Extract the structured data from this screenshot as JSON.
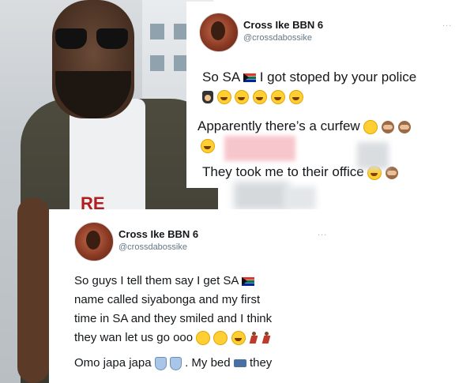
{
  "tweet1": {
    "name": "Cross Ike BBN 6",
    "handle": "@crossdabossike",
    "more": "...",
    "lines": [
      "So SA",
      "I got stoped by your police",
      "Apparently there’s a curfew",
      "They took me to their office"
    ]
  },
  "tweet2": {
    "name": "Cross Ike BBN 6",
    "handle": "@crossdabossike",
    "more": "...",
    "lines": [
      "So guys I tell them say I get SA",
      "name called siyabonga and my first",
      "time in SA and they smiled and I think",
      "they wan let us go ooo",
      "Omo japa japa",
      ". My bed",
      "they"
    ]
  },
  "photo": {
    "shirt_print": "RE"
  },
  "emojis": [
    "sa-flag",
    "police-officer",
    "laughing-face",
    "see-no-evil-monkey",
    "running-person",
    "shield",
    "bed"
  ]
}
